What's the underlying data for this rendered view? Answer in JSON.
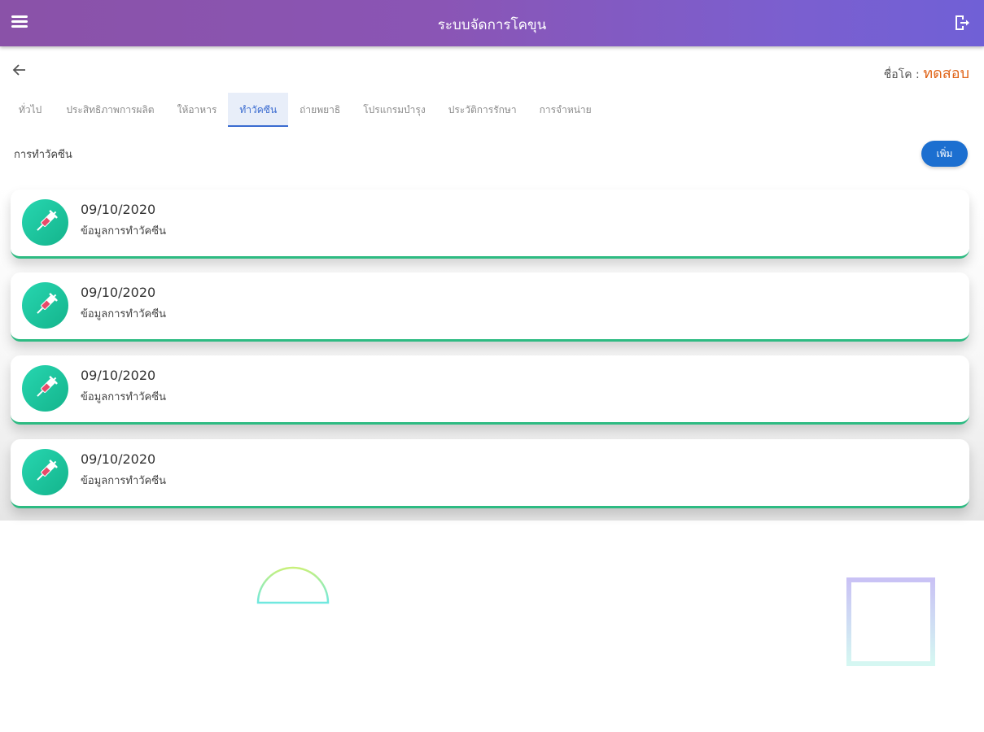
{
  "appbar": {
    "title": "ระบบจัดการโคขุน",
    "menu_icon": "menu-icon",
    "logout_icon": "logout-icon"
  },
  "header": {
    "back_icon": "arrow-left-icon",
    "name_label": "ชื่อโค :",
    "name_value": "ทดสอบ"
  },
  "tabs": [
    {
      "label": "ทั่วไป",
      "active": false
    },
    {
      "label": "ประสิทธิภาพการผลิต",
      "active": false
    },
    {
      "label": "ให้อาหาร",
      "active": false
    },
    {
      "label": "ทำวัคซีน",
      "active": true
    },
    {
      "label": "ถ่ายพยาธิ",
      "active": false
    },
    {
      "label": "โปรแกรมบำรุง",
      "active": false
    },
    {
      "label": "ประวัติการรักษา",
      "active": false
    },
    {
      "label": "การจำหน่าย",
      "active": false
    }
  ],
  "section": {
    "title": "การทำวัคซีน",
    "add_label": "เพิ่ม"
  },
  "records": [
    {
      "date": "09/10/2020",
      "desc": "ข้อมูลการทำวัคซีน",
      "icon": "syringe-icon"
    },
    {
      "date": "09/10/2020",
      "desc": "ข้อมูลการทำวัคซีน",
      "icon": "syringe-icon"
    },
    {
      "date": "09/10/2020",
      "desc": "ข้อมูลการทำวัคซีน",
      "icon": "syringe-icon"
    },
    {
      "date": "09/10/2020",
      "desc": "ข้อมูลการทำวัคซีน",
      "icon": "syringe-icon"
    }
  ],
  "colors": {
    "appbar_start": "#8a52a8",
    "appbar_end": "#7060d6",
    "active_tab": "#3a6bd0",
    "add_button": "#1c6fd0",
    "card_accent": "#2dbb82",
    "name_value": "#e0651a"
  }
}
